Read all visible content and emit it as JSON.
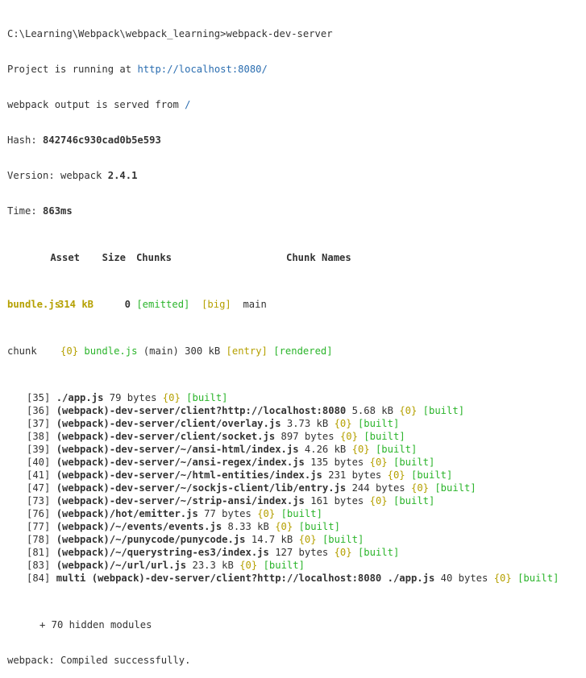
{
  "terminal": {
    "command_line": "C:\\Learning\\Webpack\\webpack_learning>webpack-dev-server",
    "project_running_prefix": "Project is running at ",
    "project_url": "http://localhost:8080/",
    "served_from_prefix": "webpack output is served from ",
    "served_from_path": "/",
    "hash_label": "Hash: ",
    "hash_value": "842746c930cad0b5e593",
    "version_label": "Version: webpack ",
    "version_value": "2.4.1",
    "time_label": "Time: ",
    "time_value": "863ms",
    "stats_header": {
      "asset": "Asset",
      "size": "Size",
      "chunks": "Chunks",
      "chunk_names": "Chunk Names"
    },
    "asset_row": {
      "name": "bundle.js",
      "size": "314 kB",
      "chunk": "0",
      "emitted": "[emitted]",
      "big": "[big]",
      "chunk_name": "main"
    },
    "chunk_row": {
      "label": "chunk",
      "id": "{0}",
      "file": "bundle.js",
      "details": " (main) 300 kB ",
      "entry": "[entry]",
      "rendered": "[rendered]"
    },
    "modules": [
      {
        "id": "[35]",
        "path": "./app.js",
        "size": "79 bytes",
        "chunk": "{0}",
        "status": "[built]"
      },
      {
        "id": "[36]",
        "path": "(webpack)-dev-server/client?http://localhost:8080",
        "size": "5.68 kB",
        "chunk": "{0}",
        "status": "[built]"
      },
      {
        "id": "[37]",
        "path": "(webpack)-dev-server/client/overlay.js",
        "size": "3.73 kB",
        "chunk": "{0}",
        "status": "[built]"
      },
      {
        "id": "[38]",
        "path": "(webpack)-dev-server/client/socket.js",
        "size": "897 bytes",
        "chunk": "{0}",
        "status": "[built]"
      },
      {
        "id": "[39]",
        "path": "(webpack)-dev-server/~/ansi-html/index.js",
        "size": "4.26 kB",
        "chunk": "{0}",
        "status": "[built]"
      },
      {
        "id": "[40]",
        "path": "(webpack)-dev-server/~/ansi-regex/index.js",
        "size": "135 bytes",
        "chunk": "{0}",
        "status": "[built]"
      },
      {
        "id": "[41]",
        "path": "(webpack)-dev-server/~/html-entities/index.js",
        "size": "231 bytes",
        "chunk": "{0}",
        "status": "[built]"
      },
      {
        "id": "[47]",
        "path": "(webpack)-dev-server/~/sockjs-client/lib/entry.js",
        "size": "244 bytes",
        "chunk": "{0}",
        "status": "[built]"
      },
      {
        "id": "[73]",
        "path": "(webpack)-dev-server/~/strip-ansi/index.js",
        "size": "161 bytes",
        "chunk": "{0}",
        "status": "[built]"
      },
      {
        "id": "[76]",
        "path": "(webpack)/hot/emitter.js",
        "size": "77 bytes",
        "chunk": "{0}",
        "status": "[built]"
      },
      {
        "id": "[77]",
        "path": "(webpack)/~/events/events.js",
        "size": "8.33 kB",
        "chunk": "{0}",
        "status": "[built]"
      },
      {
        "id": "[78]",
        "path": "(webpack)/~/punycode/punycode.js",
        "size": "14.7 kB",
        "chunk": "{0}",
        "status": "[built]"
      },
      {
        "id": "[81]",
        "path": "(webpack)/~/querystring-es3/index.js",
        "size": "127 bytes",
        "chunk": "{0}",
        "status": "[built]"
      },
      {
        "id": "[83]",
        "path": "(webpack)/~/url/url.js",
        "size": "23.3 kB",
        "chunk": "{0}",
        "status": "[built]"
      },
      {
        "id": "[84]",
        "path": "multi (webpack)-dev-server/client?http://localhost:8080 ./app.js",
        "size": "40 bytes",
        "chunk": "{0}",
        "status": "[built]"
      }
    ],
    "hidden_modules": "+ 70 hidden modules",
    "compiled_message": "webpack: Compiled successfully."
  },
  "colors": {
    "text": "#333333",
    "link": "#2a6db0",
    "yellow": "#b5a000",
    "green": "#2ab42a",
    "background": "#ffffff"
  }
}
